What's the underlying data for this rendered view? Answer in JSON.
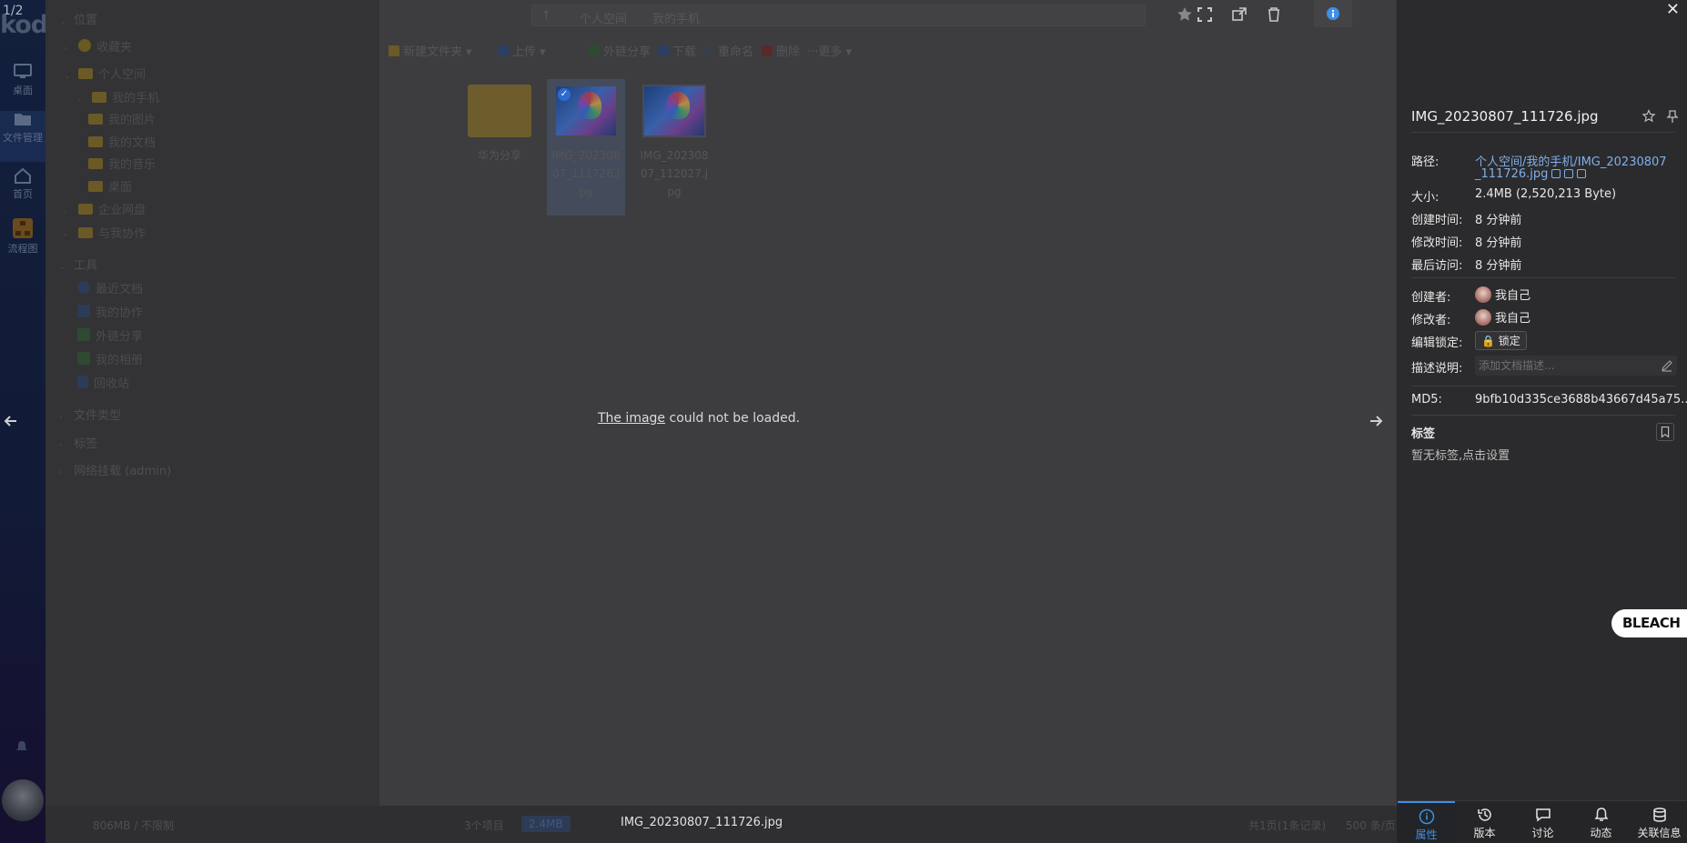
{
  "viewer": {
    "counter": "1/2",
    "logo": "kod",
    "load_message_link": "The image",
    "load_message_rest": " could not be loaded.",
    "caption": "IMG_20230807_111726.jpg"
  },
  "rail": {
    "items": [
      {
        "label": "桌面",
        "icon": "desktop-icon"
      },
      {
        "label": "文件管理",
        "icon": "folder-icon"
      },
      {
        "label": "首页",
        "icon": "home-icon"
      },
      {
        "label": "流程图",
        "icon": "flowchart-icon"
      }
    ]
  },
  "tree": {
    "location_header": "位置",
    "favorites": "收藏夹",
    "personal_space": "个人空间",
    "folders": [
      "我的手机",
      "我的图片",
      "我的文档",
      "我的音乐",
      "桌面"
    ],
    "enterprise_disk": "企业网盘",
    "shared_with_me": "与我协作",
    "tools_header": "工具",
    "tools": [
      "最近文档",
      "我的协作",
      "外链分享",
      "我的相册",
      "回收站"
    ],
    "file_types": "文件类型",
    "tags": "标签",
    "network_mount": "网络挂载 (admin)"
  },
  "main": {
    "breadcrumb": [
      "个人空间",
      "我的手机"
    ],
    "actions": {
      "new_folder": "新建文件夹",
      "upload": "上传",
      "external_share": "外链分享",
      "download": "下载",
      "rename": "重命名",
      "delete": "删除",
      "more": "更多"
    },
    "files": [
      {
        "name": "华为分享",
        "kind": "folder",
        "selected": false
      },
      {
        "name": "IMG_20230807_111726.jpg",
        "kind": "image",
        "selected": true
      },
      {
        "name": "IMG_20230807_112027.jpg",
        "kind": "image",
        "selected": false
      }
    ]
  },
  "status": {
    "storage": "806MB / 不限制",
    "item_count": "3个项目",
    "selected_size": "2.4MB",
    "pagination": "共1页",
    "pagination_hint": "(1条记录)",
    "per_page": "500 条/页"
  },
  "panel": {
    "file_name": "IMG_20230807_111726.jpg",
    "labels": {
      "path": "路径:",
      "size": "大小:",
      "created": "创建时间:",
      "modified": "修改时间:",
      "accessed": "最后访问:",
      "creator": "创建者:",
      "modifier": "修改者:",
      "edit_lock": "编辑锁定:",
      "description": "描述说明:",
      "md5": "MD5:",
      "tags_header": "标签"
    },
    "path_line1": "个人空间/我的手机/IMG_20230807",
    "path_line2": "_111726.jpg",
    "size": "2.4MB (2,520,213 Byte)",
    "created": "8 分钟前",
    "modified": "8 分钟前",
    "accessed": "8 分钟前",
    "creator": "我自己",
    "modifier": "我自己",
    "lock_button": "锁定",
    "description_placeholder": "添加文档描述...",
    "md5": "9bfb10d335ce3688b43667d45a75...",
    "tags_hint": "暂无标签,点击设置",
    "bleach_badge": "BLEACH",
    "tabs": [
      "属性",
      "版本",
      "讨论",
      "动态",
      "关联信息"
    ],
    "active_tab": "属性"
  },
  "colors": {
    "accent": "#3d8fe8",
    "link": "#7fb0e8",
    "panel_bg": "#2b2b2d"
  }
}
